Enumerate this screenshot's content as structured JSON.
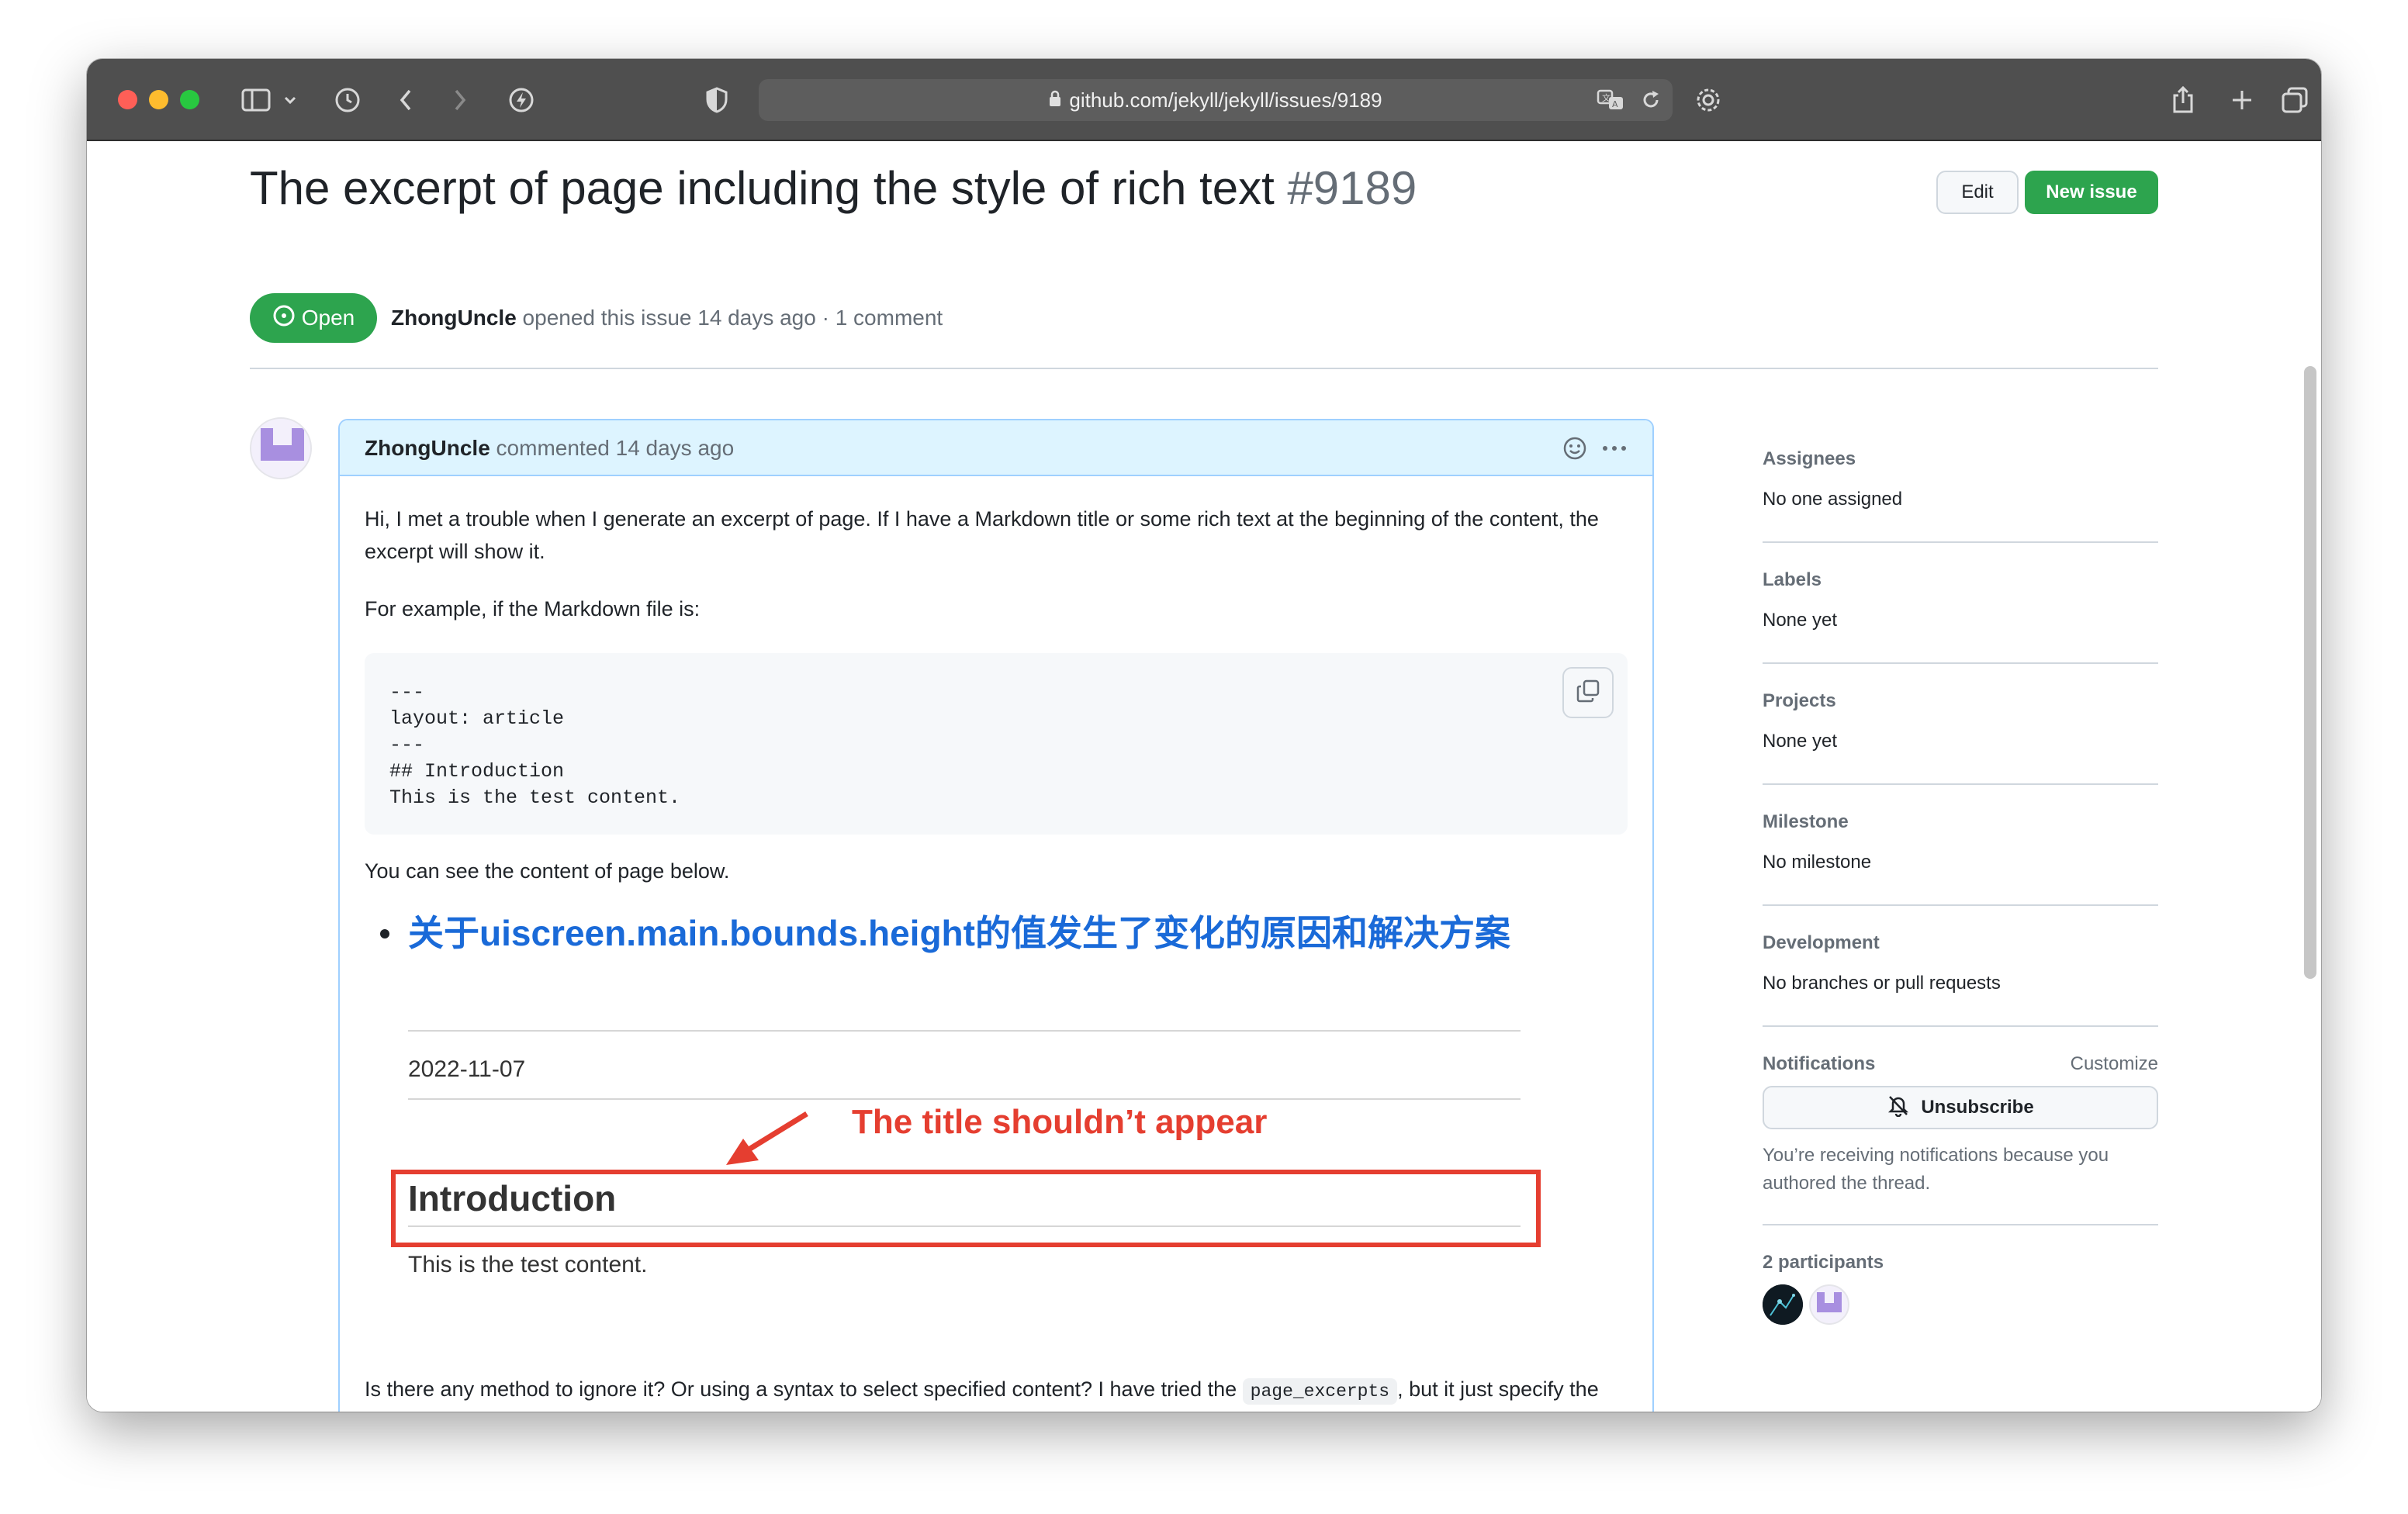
{
  "browser": {
    "url": "github.com/jekyll/jekyll/issues/9189"
  },
  "issue": {
    "title": "The excerpt of page including the style of rich text",
    "number": "#9189",
    "state": "Open",
    "author": "ZhongUncle",
    "meta": "opened this issue 14 days ago · 1 comment",
    "edit_label": "Edit",
    "new_issue_label": "New issue"
  },
  "comment": {
    "author": "ZhongUncle",
    "time": "commented 14 days ago",
    "para1": "Hi, I met a trouble when I generate an excerpt of page. If I have a Markdown title or some rich text at the beginning of the content, the excerpt will show it.",
    "para2": "For example, if the Markdown file is:",
    "code": "---\nlayout: article\n---\n## Introduction\nThis is the test content.",
    "para3": "You can see the content of page below.",
    "post_title": "关于uiscreen.main.bounds.height的值发生了变化的原因和解决方案",
    "post_date": "2022-11-07",
    "annotation": "The title shouldn’t appear",
    "intro_heading": "Introduction",
    "post_body": "This is the test content.",
    "para4_a": "Is there any method to ignore it? Or using a syntax to select specified content? I have tried the",
    "para4_code": "page_excerpts",
    "para4_b": ", but it just specify the content from the beginning, and can't solve the problem."
  },
  "sidebar": {
    "assignees_title": "Assignees",
    "assignees_value": "No one assigned",
    "labels_title": "Labels",
    "labels_value": "None yet",
    "projects_title": "Projects",
    "projects_value": "None yet",
    "milestone_title": "Milestone",
    "milestone_value": "No milestone",
    "development_title": "Development",
    "development_value": "No branches or pull requests",
    "notifications_title": "Notifications",
    "customize_label": "Customize",
    "unsubscribe_label": "Unsubscribe",
    "notifications_note": "You’re receiving notifications because you authored the thread.",
    "participants_title": "2 participants"
  },
  "colors": {
    "open_green": "#2da44e",
    "link_blue": "#1a6ad8",
    "annotation_red": "#e53e30",
    "comment_header": "#ddf4ff"
  }
}
